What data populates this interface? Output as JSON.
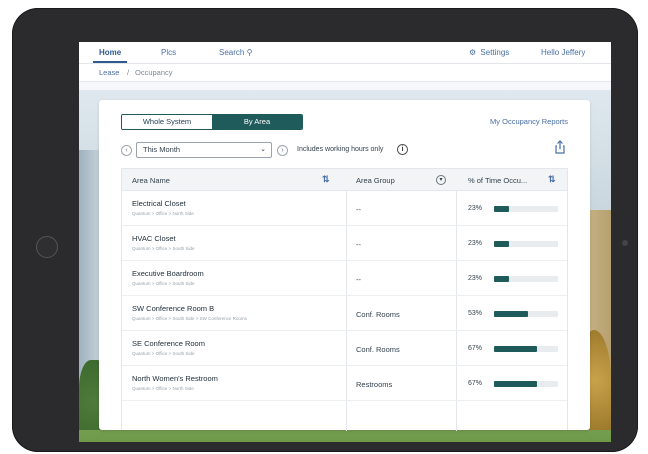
{
  "nav": {
    "home": "Home",
    "places": "Plcs",
    "search": "Search",
    "settings": "Settings",
    "user": "Hello Jeffery"
  },
  "breadcrumb": {
    "parent": "Lease",
    "separator": "/",
    "current": "Occupancy"
  },
  "toggle": {
    "options": [
      "Whole System",
      "By Area"
    ],
    "active_index": 1
  },
  "report_link": "My Occupancy Reports",
  "filter": {
    "period": "This Month",
    "working_hours_label": "Includes working hours only"
  },
  "table": {
    "headers": {
      "area": "Area Name",
      "group": "Area Group",
      "time": "% of Time Occu..."
    },
    "rows": [
      {
        "name": "Electrical Closet",
        "path": "Quantum > Office > North Side",
        "group": "--",
        "pct": "23%",
        "value": 23
      },
      {
        "name": "HVAC Closet",
        "path": "Quantum > Office > South Side",
        "group": "--",
        "pct": "23%",
        "value": 23
      },
      {
        "name": "Executive Boardroom",
        "path": "Quantum > Office > South Side",
        "group": "--",
        "pct": "23%",
        "value": 23
      },
      {
        "name": "SW Conference Room B",
        "path": "Quantum > Office > South Side > SW Conference Rooms",
        "group": "Conf. Rooms",
        "pct": "53%",
        "value": 53
      },
      {
        "name": "SE Conference Room",
        "path": "Quantum > Office > South Side",
        "group": "Conf. Rooms",
        "pct": "67%",
        "value": 67
      },
      {
        "name": "North Women's Restroom",
        "path": "Quantum > Office > North Side",
        "group": "Restrooms",
        "pct": "67%",
        "value": 67
      }
    ]
  },
  "colors": {
    "accent": "#1f5b5b",
    "link": "#4a6fa5"
  },
  "icons": {
    "search": "search-icon",
    "settings": "gear-icon",
    "sort": "sort-icon",
    "share": "share-icon",
    "info": "info-icon"
  }
}
